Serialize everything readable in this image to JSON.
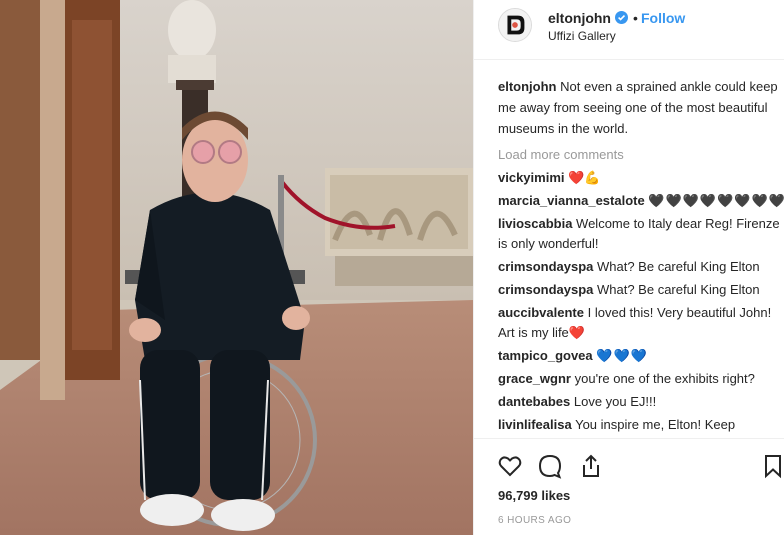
{
  "post": {
    "username": "eltonjohn",
    "separator": "•",
    "follow_label": "Follow",
    "location": "Uffizi Gallery",
    "caption": "Not even a sprained ankle could keep me away from seeing one of the most beautiful museums in the world.",
    "load_more": "Load more comments",
    "likes": "96,799 likes",
    "time": "6 HOURS AGO"
  },
  "comments": [
    {
      "user": "vickyimimi",
      "text": "",
      "emoji": "❤️💪"
    },
    {
      "user": "marcia_vianna_estalote",
      "text": "",
      "emoji": "🖤🖤🖤🖤🖤🖤🖤🖤"
    },
    {
      "user": "livioscabbia",
      "text": "Welcome to Italy dear Reg! Firenze is only wonderful!",
      "emoji": ""
    },
    {
      "user": "crimsondayspa",
      "text": "What? Be careful King Elton",
      "emoji": ""
    },
    {
      "user": "crimsondayspa",
      "text": "What? Be careful King Elton",
      "emoji": ""
    },
    {
      "user": "auccibvalente",
      "text": "I loved this! Very beautiful John! Art is my life",
      "emoji": "❤️"
    },
    {
      "user": "tampico_govea",
      "text": "",
      "emoji": "💙💙💙"
    },
    {
      "user": "grace_wgnr",
      "text": "you're one of the exhibits right?",
      "emoji": ""
    },
    {
      "user": "dantebabes",
      "text": "Love you EJ!!!",
      "emoji": ""
    },
    {
      "user": "livinlifealisa",
      "text": "You inspire me, Elton! Keep",
      "emoji": ""
    }
  ],
  "icons": {
    "verified": "verified-badge-icon",
    "like": "heart-outline-icon",
    "comment": "comment-bubble-icon",
    "share": "share-icon",
    "save": "bookmark-icon"
  },
  "colors": {
    "link": "#3897f0",
    "verified": "#3897f0",
    "muted": "#999999",
    "text": "#262626"
  }
}
